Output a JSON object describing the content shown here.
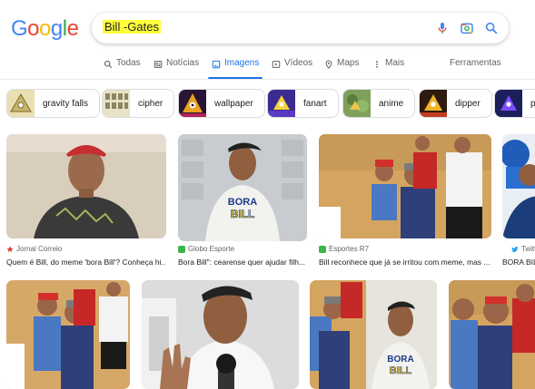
{
  "logo": {
    "letters": [
      "G",
      "o",
      "o",
      "g",
      "l",
      "e"
    ],
    "colors": [
      "#4285f4",
      "#ea4335",
      "#fbbc05",
      "#4285f4",
      "#34a853",
      "#ea4335"
    ]
  },
  "search": {
    "query": "Bill -Gates",
    "highlight_color": "#ffff3a"
  },
  "tabs": [
    {
      "label": "Todas",
      "icon": "search-icon"
    },
    {
      "label": "Notícias",
      "icon": "news-icon"
    },
    {
      "label": "Imagens",
      "icon": "image-icon",
      "active": true
    },
    {
      "label": "Vídeos",
      "icon": "play-icon"
    },
    {
      "label": "Maps",
      "icon": "map-pin-icon"
    },
    {
      "label": "Mais",
      "icon": "more-vert-icon"
    }
  ],
  "tools_label": "Ferramentas",
  "chips": [
    {
      "label": "gravity falls"
    },
    {
      "label": "cipher"
    },
    {
      "label": "wallpaper"
    },
    {
      "label": "fanart"
    },
    {
      "label": "anime"
    },
    {
      "label": "dipper"
    },
    {
      "label": "p"
    }
  ],
  "results_row1": [
    {
      "source": "Jornal Correio",
      "title": "Quem é Bill, do meme 'bora Bill'? Conheça hi...",
      "favicon_color": "#e53935"
    },
    {
      "source": "Globo Esporte",
      "title": "Bora Bill\": cearense quer ajudar filh...",
      "favicon_color": "#3bb54a"
    },
    {
      "source": "Esportes R7",
      "title": "Bill reconhece que já se irritou com meme, mas ...",
      "favicon_color": "#3bb54a"
    },
    {
      "source": "Twitter",
      "title": "BORA BILL",
      "favicon_color": "#1da1f2"
    }
  ],
  "shirt_text": [
    "BORA",
    "BILL"
  ]
}
